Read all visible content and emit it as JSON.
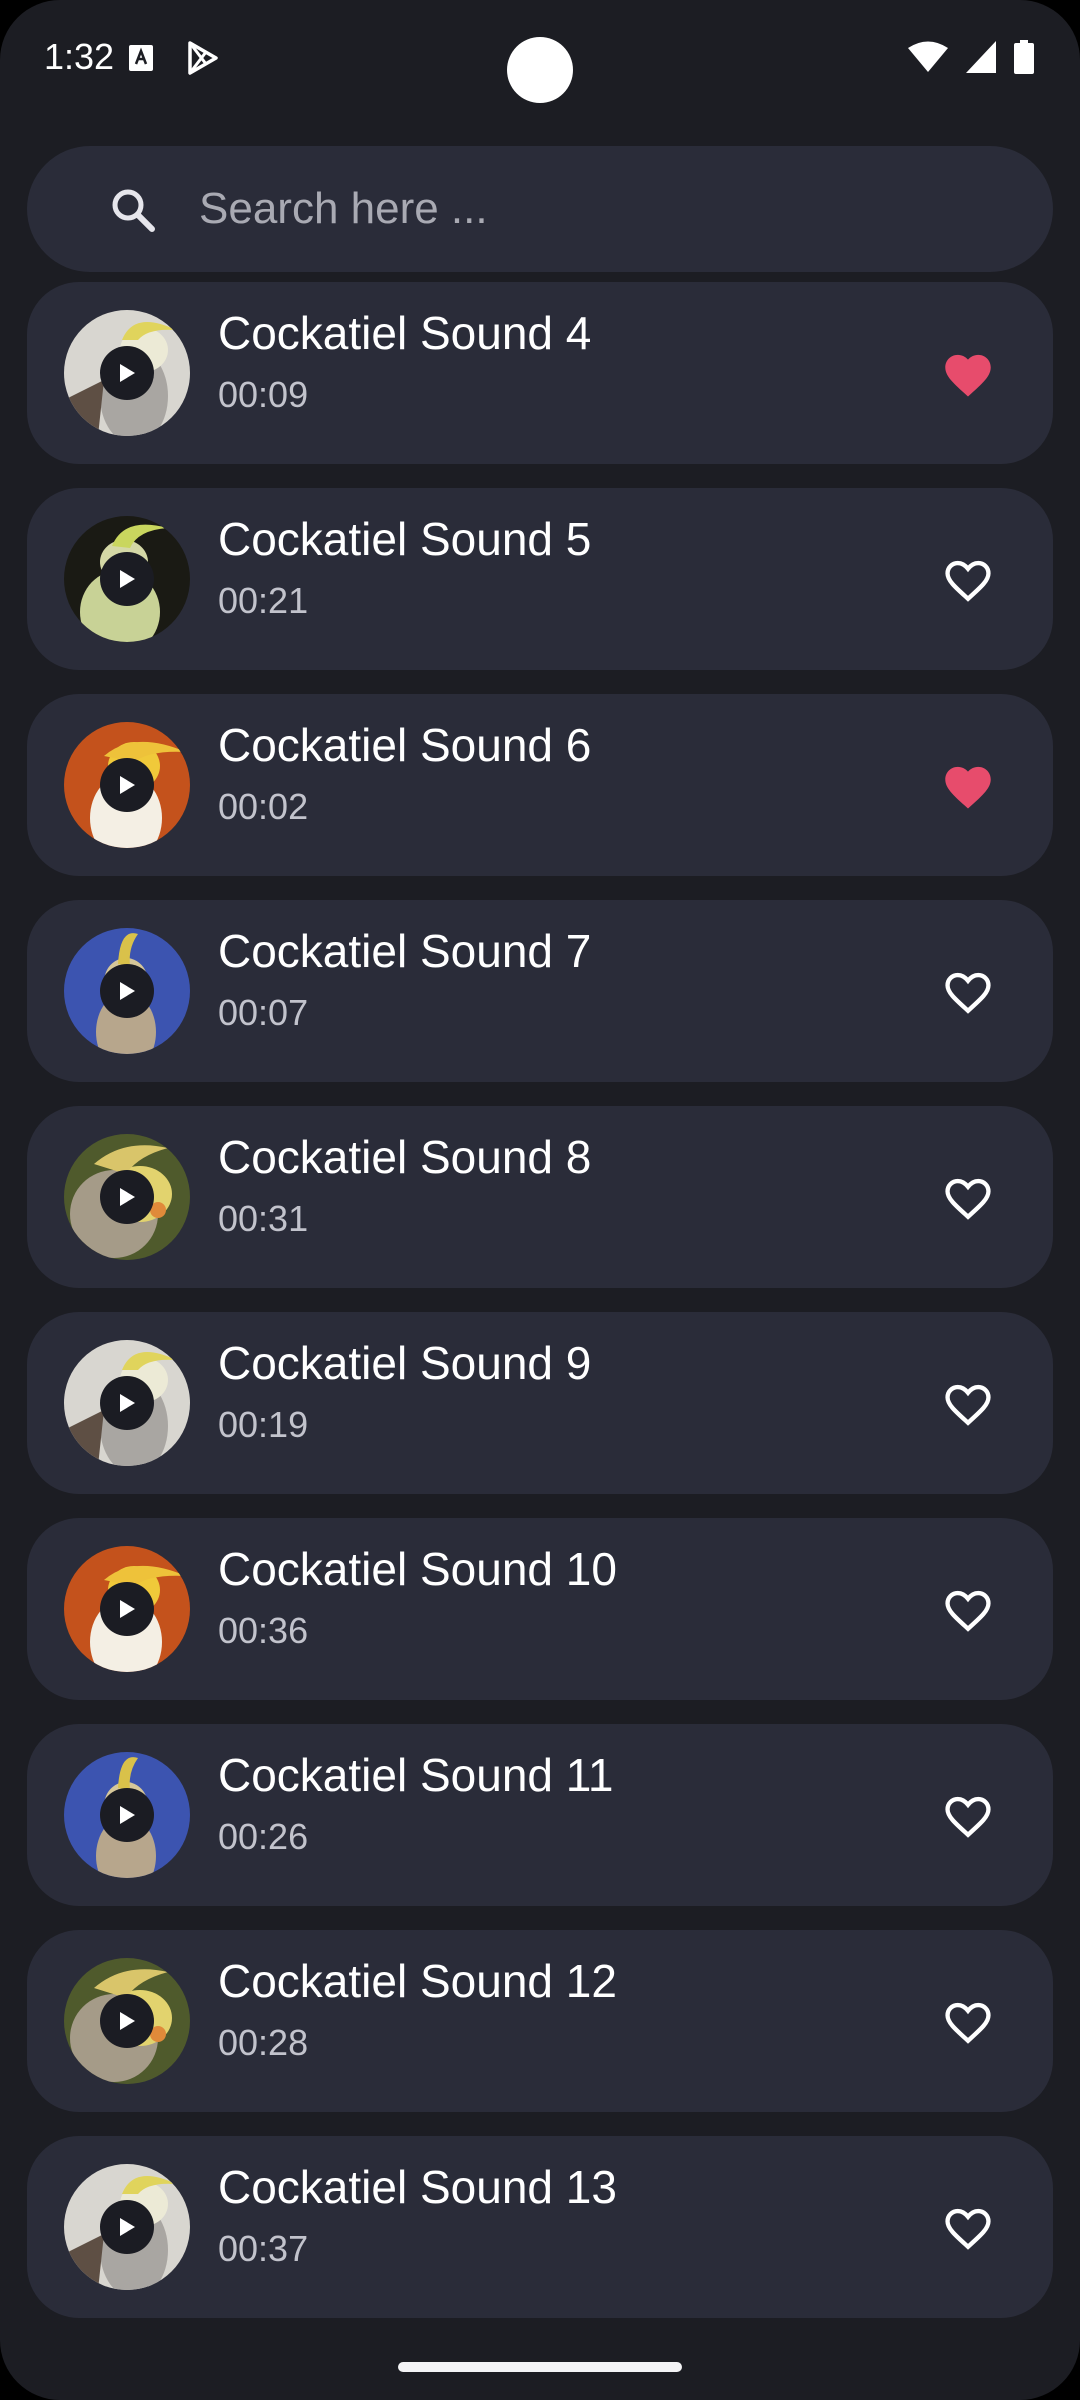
{
  "status_bar": {
    "time": "1:32",
    "icons": [
      "sim-card-icon",
      "play-store-icon",
      "wifi-icon",
      "signal-icon",
      "battery-icon"
    ]
  },
  "search": {
    "placeholder": "Search here ..."
  },
  "colors": {
    "background": "#1c1d23",
    "card": "#2a2c39",
    "favorite_active": "#e74c6c",
    "text_primary": "#ffffff",
    "text_secondary": "#c2c3cc"
  },
  "sounds": [
    {
      "title": "Cockatiel Sound 4",
      "duration": "00:09",
      "favorite": true,
      "thumb": "a"
    },
    {
      "title": "Cockatiel Sound 5",
      "duration": "00:21",
      "favorite": false,
      "thumb": "b"
    },
    {
      "title": "Cockatiel Sound 6",
      "duration": "00:02",
      "favorite": true,
      "thumb": "c"
    },
    {
      "title": "Cockatiel Sound 7",
      "duration": "00:07",
      "favorite": false,
      "thumb": "d"
    },
    {
      "title": "Cockatiel Sound 8",
      "duration": "00:31",
      "favorite": false,
      "thumb": "e"
    },
    {
      "title": "Cockatiel Sound 9",
      "duration": "00:19",
      "favorite": false,
      "thumb": "a"
    },
    {
      "title": "Cockatiel Sound 10",
      "duration": "00:36",
      "favorite": false,
      "thumb": "c"
    },
    {
      "title": "Cockatiel Sound 11",
      "duration": "00:26",
      "favorite": false,
      "thumb": "d"
    },
    {
      "title": "Cockatiel Sound 12",
      "duration": "00:28",
      "favorite": false,
      "thumb": "e"
    },
    {
      "title": "Cockatiel Sound 13",
      "duration": "00:37",
      "favorite": false,
      "thumb": "a"
    }
  ]
}
